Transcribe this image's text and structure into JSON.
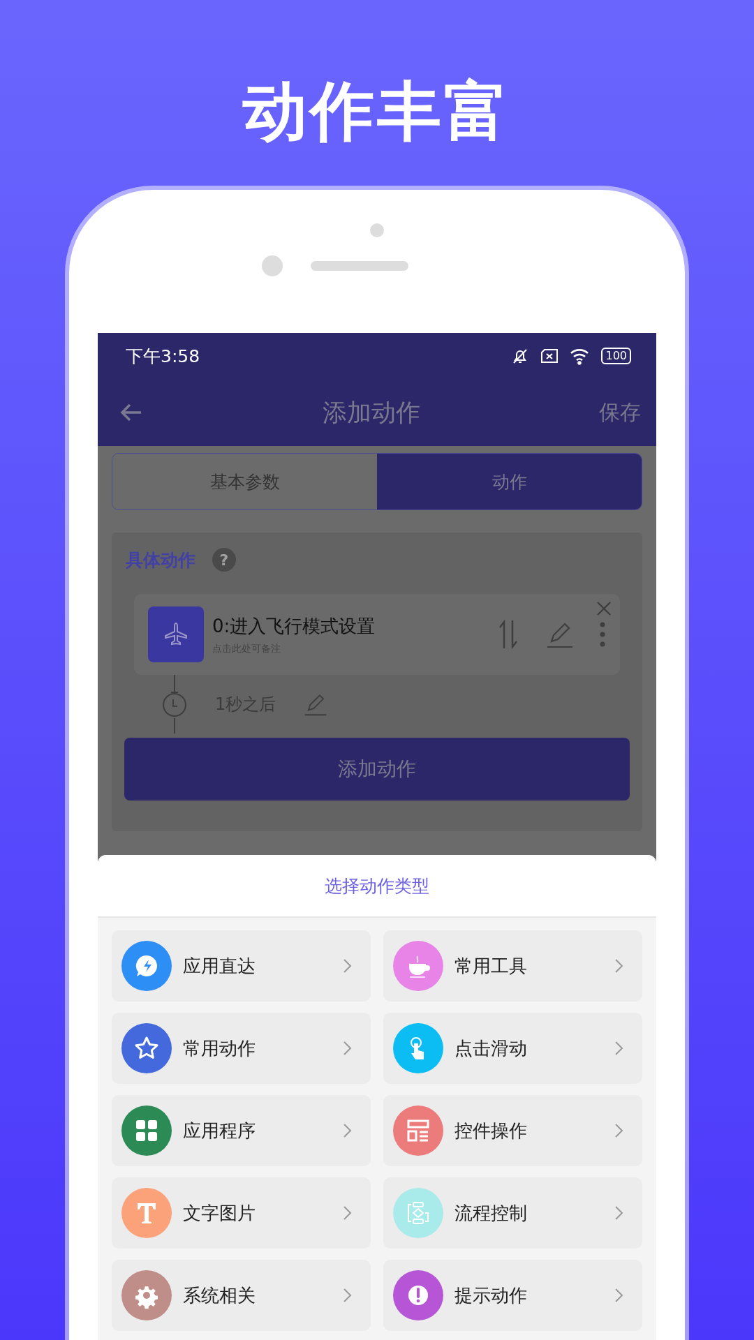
{
  "headline": "动作丰富",
  "status_bar": {
    "time": "下午3:58",
    "battery": "100"
  },
  "app_bar": {
    "title": "添加动作",
    "action": "保存"
  },
  "tabs": [
    {
      "label": "基本参数",
      "selected": false
    },
    {
      "label": "动作",
      "selected": true
    }
  ],
  "section": {
    "title": "具体动作",
    "help": "?"
  },
  "action_card": {
    "title": "0:进入飞行模式设置",
    "placeholder": "点击此处可备注"
  },
  "delay": {
    "label": "1秒之后"
  },
  "add_button": "添加动作",
  "sheet": {
    "title": "选择动作类型",
    "items": [
      {
        "label": "应用直达",
        "color": "#2d8ef5"
      },
      {
        "label": "常用工具",
        "color": "#e883e8"
      },
      {
        "label": "常用动作",
        "color": "#4469dc"
      },
      {
        "label": "点击滑动",
        "color": "#0bbdf2"
      },
      {
        "label": "应用程序",
        "color": "#2c8a55"
      },
      {
        "label": "控件操作",
        "color": "#ec7b7b"
      },
      {
        "label": "文字图片",
        "color": "#fca27a"
      },
      {
        "label": "流程控制",
        "color": "#a9ebea"
      },
      {
        "label": "系统相关",
        "color": "#bf8e88"
      },
      {
        "label": "提示动作",
        "color": "#b656d6"
      }
    ]
  }
}
